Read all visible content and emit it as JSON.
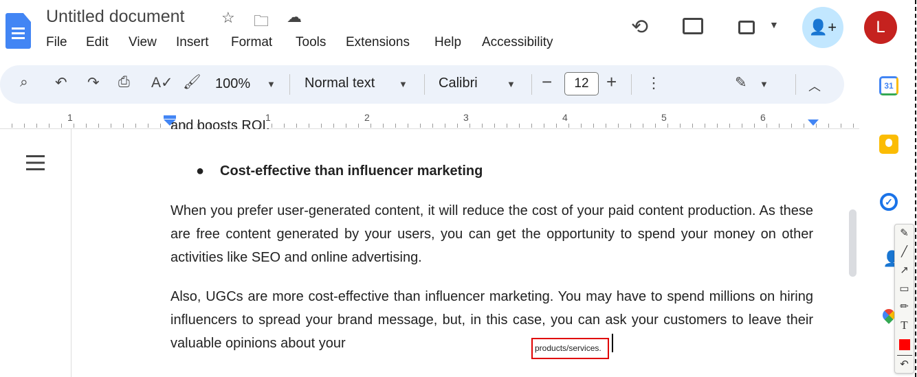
{
  "header": {
    "title": "Untitled document",
    "menu": [
      "File",
      "Edit",
      "View",
      "Insert",
      "Format",
      "Tools",
      "Extensions",
      "Help",
      "Accessibility"
    ],
    "avatar_letter": "L"
  },
  "toolbar": {
    "zoom": "100%",
    "style": "Normal text",
    "font": "Calibri",
    "font_size": "12"
  },
  "ruler": {
    "numbers": [
      "1",
      "1",
      "2",
      "3",
      "4",
      "5",
      "6"
    ]
  },
  "document": {
    "partial_line": "and boosts ROI.",
    "bullet": "Cost-effective than influencer marketing",
    "para1": "When you prefer user-generated content, it will reduce the cost of your paid content production. As these are free content generated by your users, you can get the opportunity to spend your money on other activities like SEO and online advertising.",
    "para2": "Also, UGCs are more cost-effective than influencer marketing. You may have to spend millions on hiring influencers to spread your brand message, but, in this case, you can ask your customers to leave their valuable opinions about your",
    "annotation_text": "products/services."
  },
  "side_panel": {
    "calendar_label": "31"
  },
  "colors": {
    "accent": "#1a73e8",
    "toolbar_bg": "#edf2fa",
    "share_bg": "#c2e7ff",
    "avatar": "#c5221f",
    "annotation": "#e00000"
  }
}
